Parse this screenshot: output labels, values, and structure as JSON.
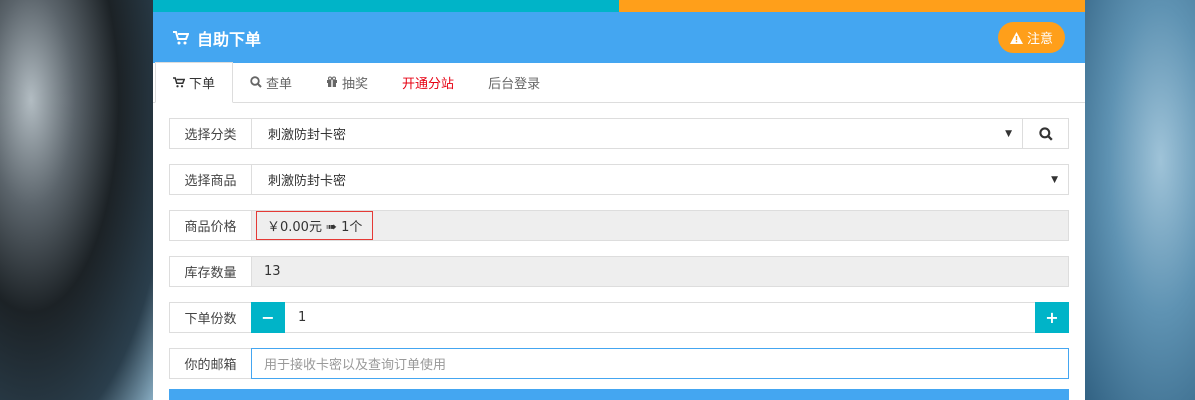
{
  "top_bar": {
    "left_label": "",
    "right_label": ""
  },
  "header": {
    "title": "自助下单",
    "notice_label": "注意"
  },
  "tabs": [
    {
      "label": "下单"
    },
    {
      "label": "查单"
    },
    {
      "label": "抽奖"
    },
    {
      "label": "开通分站"
    },
    {
      "label": "后台登录"
    }
  ],
  "form": {
    "category": {
      "label": "选择分类",
      "value": "刺激防封卡密"
    },
    "product": {
      "label": "选择商品",
      "value": "刺激防封卡密"
    },
    "price": {
      "label": "商品价格",
      "value": "￥0.00元 ➠ 1个"
    },
    "stock": {
      "label": "库存数量",
      "value": "13"
    },
    "quantity": {
      "label": "下单份数",
      "value": "1",
      "minus": "−",
      "plus": "+"
    },
    "email": {
      "label": "你的邮箱",
      "placeholder": "用于接收卡密以及查询订单使用"
    }
  },
  "submit": {
    "label": ""
  },
  "colors": {
    "primary": "#44a6f1",
    "teal": "#00b4c8",
    "orange": "#ff9f1a",
    "red": "#e60012"
  }
}
